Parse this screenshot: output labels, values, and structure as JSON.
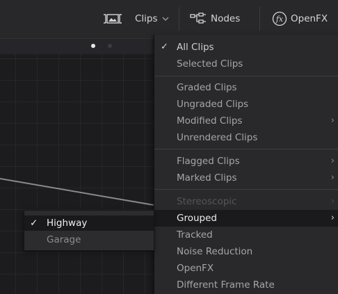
{
  "toolbar": {
    "clips_label": "Clips",
    "nodes_label": "Nodes",
    "openfx_label": "OpenFX"
  },
  "menu": {
    "items": [
      {
        "label": "All Clips",
        "checked": true
      },
      {
        "label": "Selected Clips"
      },
      {
        "label": "Graded Clips"
      },
      {
        "label": "Ungraded Clips"
      },
      {
        "label": "Modified Clips",
        "submenu": true
      },
      {
        "label": "Unrendered Clips"
      },
      {
        "label": "Flagged Clips",
        "submenu": true
      },
      {
        "label": "Marked Clips",
        "submenu": true
      },
      {
        "label": "Stereoscopic",
        "submenu": true,
        "disabled": true
      },
      {
        "label": "Grouped",
        "submenu": true,
        "highlighted": true
      },
      {
        "label": "Tracked"
      },
      {
        "label": "Noise Reduction"
      },
      {
        "label": "OpenFX"
      },
      {
        "label": "Different Frame Rate"
      }
    ]
  },
  "submenu": {
    "items": [
      {
        "label": "Highway",
        "checked": true
      },
      {
        "label": "Garage"
      }
    ]
  },
  "icons": {
    "clips": "clips-filmstrip-icon",
    "chevron": "chevron-down-icon",
    "nodes": "nodes-icon",
    "openfx": "fx-icon",
    "check": "checkmark-icon",
    "submenu_arrow": "chevron-right-icon"
  },
  "colors": {
    "background": "#1c1c1e",
    "menu_background": "#29292c",
    "highlight": "#1a1a1c",
    "text": "#a6a6a8"
  }
}
